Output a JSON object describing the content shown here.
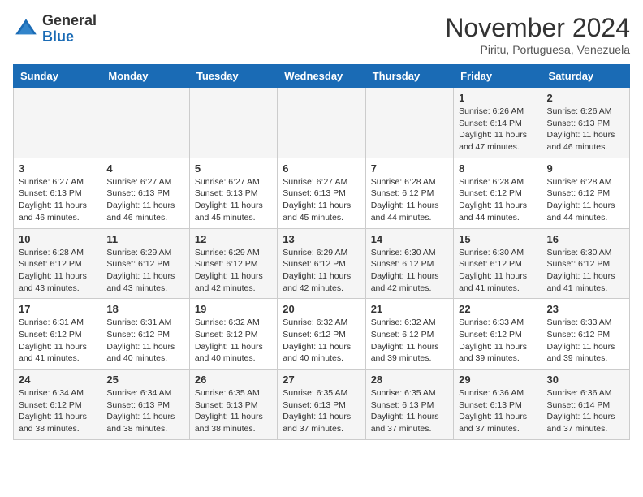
{
  "header": {
    "logo_general": "General",
    "logo_blue": "Blue",
    "month_title": "November 2024",
    "location": "Piritu, Portuguesa, Venezuela"
  },
  "weekdays": [
    "Sunday",
    "Monday",
    "Tuesday",
    "Wednesday",
    "Thursday",
    "Friday",
    "Saturday"
  ],
  "weeks": [
    [
      {
        "day": "",
        "info": ""
      },
      {
        "day": "",
        "info": ""
      },
      {
        "day": "",
        "info": ""
      },
      {
        "day": "",
        "info": ""
      },
      {
        "day": "",
        "info": ""
      },
      {
        "day": "1",
        "info": "Sunrise: 6:26 AM\nSunset: 6:14 PM\nDaylight: 11 hours and 47 minutes."
      },
      {
        "day": "2",
        "info": "Sunrise: 6:26 AM\nSunset: 6:13 PM\nDaylight: 11 hours and 46 minutes."
      }
    ],
    [
      {
        "day": "3",
        "info": "Sunrise: 6:27 AM\nSunset: 6:13 PM\nDaylight: 11 hours and 46 minutes."
      },
      {
        "day": "4",
        "info": "Sunrise: 6:27 AM\nSunset: 6:13 PM\nDaylight: 11 hours and 46 minutes."
      },
      {
        "day": "5",
        "info": "Sunrise: 6:27 AM\nSunset: 6:13 PM\nDaylight: 11 hours and 45 minutes."
      },
      {
        "day": "6",
        "info": "Sunrise: 6:27 AM\nSunset: 6:13 PM\nDaylight: 11 hours and 45 minutes."
      },
      {
        "day": "7",
        "info": "Sunrise: 6:28 AM\nSunset: 6:12 PM\nDaylight: 11 hours and 44 minutes."
      },
      {
        "day": "8",
        "info": "Sunrise: 6:28 AM\nSunset: 6:12 PM\nDaylight: 11 hours and 44 minutes."
      },
      {
        "day": "9",
        "info": "Sunrise: 6:28 AM\nSunset: 6:12 PM\nDaylight: 11 hours and 44 minutes."
      }
    ],
    [
      {
        "day": "10",
        "info": "Sunrise: 6:28 AM\nSunset: 6:12 PM\nDaylight: 11 hours and 43 minutes."
      },
      {
        "day": "11",
        "info": "Sunrise: 6:29 AM\nSunset: 6:12 PM\nDaylight: 11 hours and 43 minutes."
      },
      {
        "day": "12",
        "info": "Sunrise: 6:29 AM\nSunset: 6:12 PM\nDaylight: 11 hours and 42 minutes."
      },
      {
        "day": "13",
        "info": "Sunrise: 6:29 AM\nSunset: 6:12 PM\nDaylight: 11 hours and 42 minutes."
      },
      {
        "day": "14",
        "info": "Sunrise: 6:30 AM\nSunset: 6:12 PM\nDaylight: 11 hours and 42 minutes."
      },
      {
        "day": "15",
        "info": "Sunrise: 6:30 AM\nSunset: 6:12 PM\nDaylight: 11 hours and 41 minutes."
      },
      {
        "day": "16",
        "info": "Sunrise: 6:30 AM\nSunset: 6:12 PM\nDaylight: 11 hours and 41 minutes."
      }
    ],
    [
      {
        "day": "17",
        "info": "Sunrise: 6:31 AM\nSunset: 6:12 PM\nDaylight: 11 hours and 41 minutes."
      },
      {
        "day": "18",
        "info": "Sunrise: 6:31 AM\nSunset: 6:12 PM\nDaylight: 11 hours and 40 minutes."
      },
      {
        "day": "19",
        "info": "Sunrise: 6:32 AM\nSunset: 6:12 PM\nDaylight: 11 hours and 40 minutes."
      },
      {
        "day": "20",
        "info": "Sunrise: 6:32 AM\nSunset: 6:12 PM\nDaylight: 11 hours and 40 minutes."
      },
      {
        "day": "21",
        "info": "Sunrise: 6:32 AM\nSunset: 6:12 PM\nDaylight: 11 hours and 39 minutes."
      },
      {
        "day": "22",
        "info": "Sunrise: 6:33 AM\nSunset: 6:12 PM\nDaylight: 11 hours and 39 minutes."
      },
      {
        "day": "23",
        "info": "Sunrise: 6:33 AM\nSunset: 6:12 PM\nDaylight: 11 hours and 39 minutes."
      }
    ],
    [
      {
        "day": "24",
        "info": "Sunrise: 6:34 AM\nSunset: 6:12 PM\nDaylight: 11 hours and 38 minutes."
      },
      {
        "day": "25",
        "info": "Sunrise: 6:34 AM\nSunset: 6:13 PM\nDaylight: 11 hours and 38 minutes."
      },
      {
        "day": "26",
        "info": "Sunrise: 6:35 AM\nSunset: 6:13 PM\nDaylight: 11 hours and 38 minutes."
      },
      {
        "day": "27",
        "info": "Sunrise: 6:35 AM\nSunset: 6:13 PM\nDaylight: 11 hours and 37 minutes."
      },
      {
        "day": "28",
        "info": "Sunrise: 6:35 AM\nSunset: 6:13 PM\nDaylight: 11 hours and 37 minutes."
      },
      {
        "day": "29",
        "info": "Sunrise: 6:36 AM\nSunset: 6:13 PM\nDaylight: 11 hours and 37 minutes."
      },
      {
        "day": "30",
        "info": "Sunrise: 6:36 AM\nSunset: 6:14 PM\nDaylight: 11 hours and 37 minutes."
      }
    ]
  ]
}
